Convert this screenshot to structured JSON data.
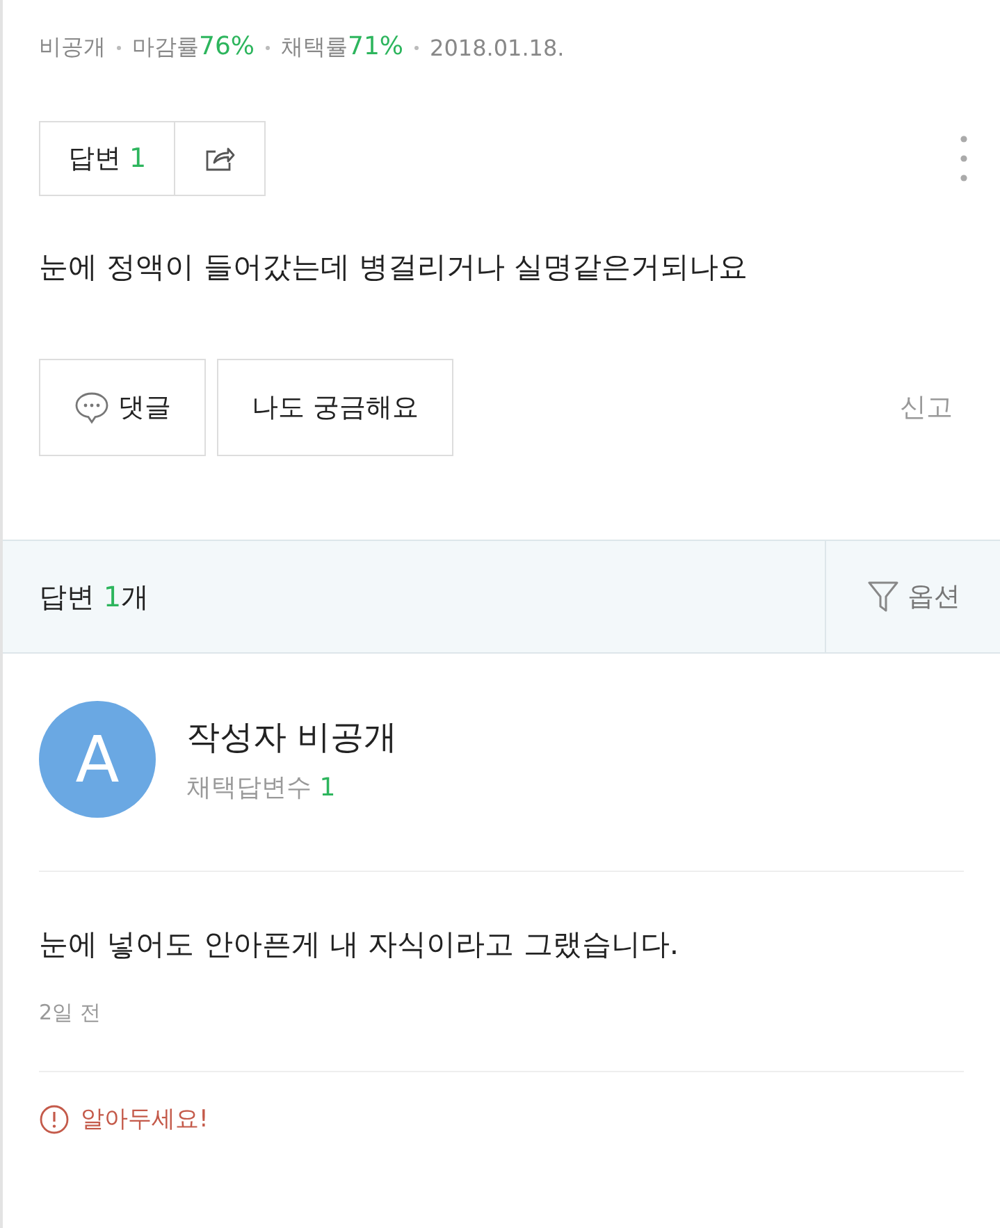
{
  "question": {
    "meta": [
      {
        "label": "비공개"
      },
      {
        "label": "마감률",
        "value": "76%"
      },
      {
        "label": "채택률",
        "value": "71%"
      },
      {
        "label": "2018.01.18."
      }
    ],
    "answer_button": {
      "label": "답변",
      "count": "1"
    },
    "text": "눈에 정액이 들어갔는데 병걸리거나 실명같은거되나요",
    "actions": [
      {
        "kind": "comment",
        "label": "댓글"
      },
      {
        "kind": "plain",
        "label": "나도 궁금해요"
      }
    ],
    "report": "신고"
  },
  "answers_header": {
    "label": "답변",
    "count": "1",
    "suffix": "개",
    "option": "옵션"
  },
  "answer": {
    "avatar": "A",
    "author": "작성자 비공개",
    "stat_label": "채택답변수",
    "stat_value": "1",
    "text": "눈에 넣어도 안아픈게 내 자식이라고 그랬습니다.",
    "time": "2일 전",
    "notice": "알아두세요!"
  }
}
